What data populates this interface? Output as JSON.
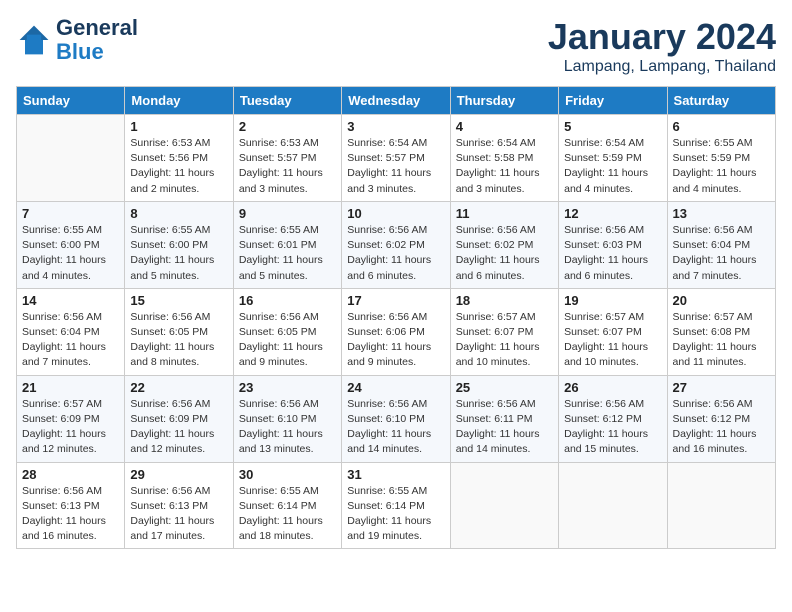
{
  "header": {
    "logo_line1": "General",
    "logo_line2": "Blue",
    "month": "January 2024",
    "location": "Lampang, Lampang, Thailand"
  },
  "weekdays": [
    "Sunday",
    "Monday",
    "Tuesday",
    "Wednesday",
    "Thursday",
    "Friday",
    "Saturday"
  ],
  "weeks": [
    [
      {
        "day": "",
        "info": ""
      },
      {
        "day": "1",
        "info": "Sunrise: 6:53 AM\nSunset: 5:56 PM\nDaylight: 11 hours\nand 2 minutes."
      },
      {
        "day": "2",
        "info": "Sunrise: 6:53 AM\nSunset: 5:57 PM\nDaylight: 11 hours\nand 3 minutes."
      },
      {
        "day": "3",
        "info": "Sunrise: 6:54 AM\nSunset: 5:57 PM\nDaylight: 11 hours\nand 3 minutes."
      },
      {
        "day": "4",
        "info": "Sunrise: 6:54 AM\nSunset: 5:58 PM\nDaylight: 11 hours\nand 3 minutes."
      },
      {
        "day": "5",
        "info": "Sunrise: 6:54 AM\nSunset: 5:59 PM\nDaylight: 11 hours\nand 4 minutes."
      },
      {
        "day": "6",
        "info": "Sunrise: 6:55 AM\nSunset: 5:59 PM\nDaylight: 11 hours\nand 4 minutes."
      }
    ],
    [
      {
        "day": "7",
        "info": "Sunrise: 6:55 AM\nSunset: 6:00 PM\nDaylight: 11 hours\nand 4 minutes."
      },
      {
        "day": "8",
        "info": "Sunrise: 6:55 AM\nSunset: 6:00 PM\nDaylight: 11 hours\nand 5 minutes."
      },
      {
        "day": "9",
        "info": "Sunrise: 6:55 AM\nSunset: 6:01 PM\nDaylight: 11 hours\nand 5 minutes."
      },
      {
        "day": "10",
        "info": "Sunrise: 6:56 AM\nSunset: 6:02 PM\nDaylight: 11 hours\nand 6 minutes."
      },
      {
        "day": "11",
        "info": "Sunrise: 6:56 AM\nSunset: 6:02 PM\nDaylight: 11 hours\nand 6 minutes."
      },
      {
        "day": "12",
        "info": "Sunrise: 6:56 AM\nSunset: 6:03 PM\nDaylight: 11 hours\nand 6 minutes."
      },
      {
        "day": "13",
        "info": "Sunrise: 6:56 AM\nSunset: 6:04 PM\nDaylight: 11 hours\nand 7 minutes."
      }
    ],
    [
      {
        "day": "14",
        "info": "Sunrise: 6:56 AM\nSunset: 6:04 PM\nDaylight: 11 hours\nand 7 minutes."
      },
      {
        "day": "15",
        "info": "Sunrise: 6:56 AM\nSunset: 6:05 PM\nDaylight: 11 hours\nand 8 minutes."
      },
      {
        "day": "16",
        "info": "Sunrise: 6:56 AM\nSunset: 6:05 PM\nDaylight: 11 hours\nand 9 minutes."
      },
      {
        "day": "17",
        "info": "Sunrise: 6:56 AM\nSunset: 6:06 PM\nDaylight: 11 hours\nand 9 minutes."
      },
      {
        "day": "18",
        "info": "Sunrise: 6:57 AM\nSunset: 6:07 PM\nDaylight: 11 hours\nand 10 minutes."
      },
      {
        "day": "19",
        "info": "Sunrise: 6:57 AM\nSunset: 6:07 PM\nDaylight: 11 hours\nand 10 minutes."
      },
      {
        "day": "20",
        "info": "Sunrise: 6:57 AM\nSunset: 6:08 PM\nDaylight: 11 hours\nand 11 minutes."
      }
    ],
    [
      {
        "day": "21",
        "info": "Sunrise: 6:57 AM\nSunset: 6:09 PM\nDaylight: 11 hours\nand 12 minutes."
      },
      {
        "day": "22",
        "info": "Sunrise: 6:56 AM\nSunset: 6:09 PM\nDaylight: 11 hours\nand 12 minutes."
      },
      {
        "day": "23",
        "info": "Sunrise: 6:56 AM\nSunset: 6:10 PM\nDaylight: 11 hours\nand 13 minutes."
      },
      {
        "day": "24",
        "info": "Sunrise: 6:56 AM\nSunset: 6:10 PM\nDaylight: 11 hours\nand 14 minutes."
      },
      {
        "day": "25",
        "info": "Sunrise: 6:56 AM\nSunset: 6:11 PM\nDaylight: 11 hours\nand 14 minutes."
      },
      {
        "day": "26",
        "info": "Sunrise: 6:56 AM\nSunset: 6:12 PM\nDaylight: 11 hours\nand 15 minutes."
      },
      {
        "day": "27",
        "info": "Sunrise: 6:56 AM\nSunset: 6:12 PM\nDaylight: 11 hours\nand 16 minutes."
      }
    ],
    [
      {
        "day": "28",
        "info": "Sunrise: 6:56 AM\nSunset: 6:13 PM\nDaylight: 11 hours\nand 16 minutes."
      },
      {
        "day": "29",
        "info": "Sunrise: 6:56 AM\nSunset: 6:13 PM\nDaylight: 11 hours\nand 17 minutes."
      },
      {
        "day": "30",
        "info": "Sunrise: 6:55 AM\nSunset: 6:14 PM\nDaylight: 11 hours\nand 18 minutes."
      },
      {
        "day": "31",
        "info": "Sunrise: 6:55 AM\nSunset: 6:14 PM\nDaylight: 11 hours\nand 19 minutes."
      },
      {
        "day": "",
        "info": ""
      },
      {
        "day": "",
        "info": ""
      },
      {
        "day": "",
        "info": ""
      }
    ]
  ]
}
